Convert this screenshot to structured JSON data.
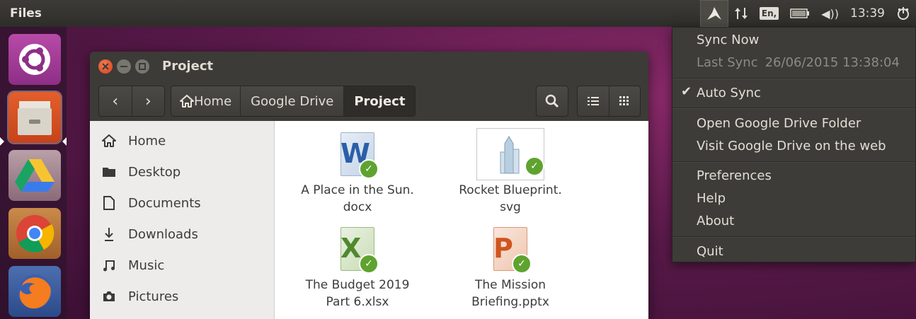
{
  "panel": {
    "app_title": "Files",
    "keyboard_layout": "En,",
    "clock": "13:39",
    "icons": [
      "google-drive-indicator-icon",
      "network-icon",
      "keyboard-layout-icon",
      "battery-icon",
      "volume-icon",
      "power-icon"
    ]
  },
  "launcher": {
    "items": [
      "ubuntu-logo",
      "files",
      "google-drive",
      "chrome",
      "firefox"
    ]
  },
  "window": {
    "title": "Project",
    "breadcrumbs": [
      "Home",
      "Google Drive",
      "Project"
    ],
    "sidebar": [
      {
        "label": "Home",
        "icon": "home-icon"
      },
      {
        "label": "Desktop",
        "icon": "folder-icon"
      },
      {
        "label": "Documents",
        "icon": "document-icon"
      },
      {
        "label": "Downloads",
        "icon": "download-icon"
      },
      {
        "label": "Music",
        "icon": "music-icon"
      },
      {
        "label": "Pictures",
        "icon": "camera-icon"
      }
    ],
    "files": [
      {
        "line1": "A Place in the Sun.",
        "line2": "docx",
        "type": "word",
        "letter": "W",
        "color": "#2a5fa8"
      },
      {
        "line1": "Rocket Blueprint.",
        "line2": "svg",
        "type": "svg",
        "letter": "",
        "color": "#9bb7cc"
      },
      {
        "line1": "The Budget 2019",
        "line2": "Part 6.xlsx",
        "type": "excel",
        "letter": "X",
        "color": "#4f8a2f"
      },
      {
        "line1": "The Mission",
        "line2": "Briefing.pptx",
        "type": "powerpoint",
        "letter": "P",
        "color": "#d0541f"
      }
    ]
  },
  "menu": {
    "sync_now": "Sync Now",
    "last_sync_label": "Last Sync",
    "last_sync_value": "26/06/2015 13:38:04",
    "auto_sync": "Auto Sync",
    "open_folder": "Open Google Drive Folder",
    "visit_web": "Visit Google Drive on the web",
    "preferences": "Preferences",
    "help": "Help",
    "about": "About",
    "quit": "Quit"
  },
  "colors": {
    "panel": "#3c3b37",
    "close_button": "#e95420",
    "sync_check": "#5fa32f"
  }
}
